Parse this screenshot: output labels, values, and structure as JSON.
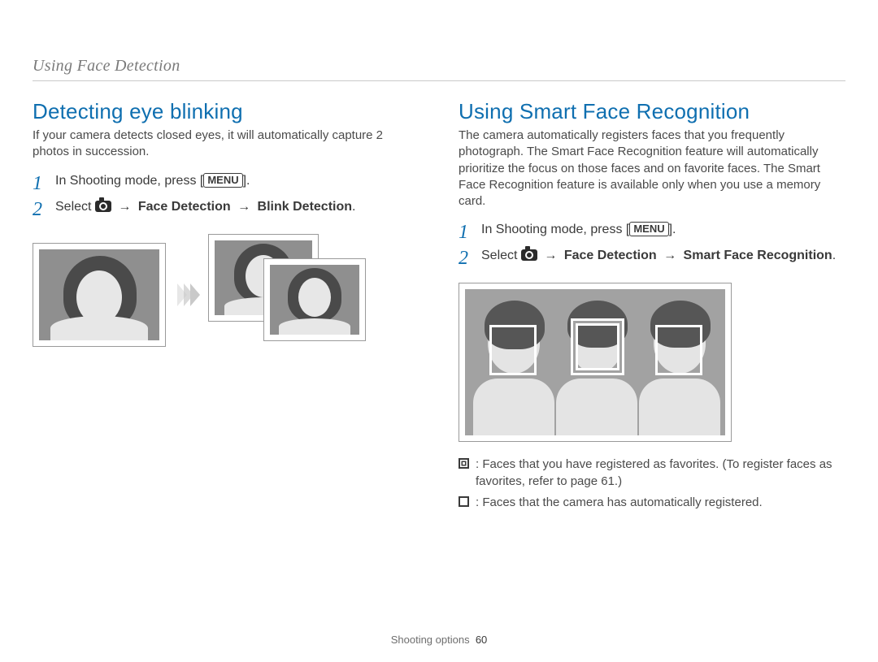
{
  "running_head": "Using Face Detection",
  "left": {
    "heading": "Detecting eye blinking",
    "intro": "If your camera detects closed eyes, it will automatically capture 2 photos in succession.",
    "step1_prefix": "In Shooting mode, press [",
    "step1_suffix": "].",
    "menu_label": "MENU",
    "step2_select": "Select ",
    "step2_path1": "Face Detection",
    "step2_path2": "Blink Detection",
    "arrow": "→",
    "period": "."
  },
  "right": {
    "heading": "Using Smart Face Recognition",
    "intro": "The camera automatically registers faces that you frequently photograph. The Smart Face Recognition feature will automatically prioritize the focus on those faces and on favorite faces. The Smart Face Recognition feature is available only when you use a memory card.",
    "step1_prefix": "In Shooting mode, press [",
    "step1_suffix": "].",
    "menu_label": "MENU",
    "step2_select": "Select ",
    "step2_path1": "Face Detection",
    "step2_path2": "Smart Face Recognition",
    "arrow": "→",
    "period": ".",
    "bullet1": " : Faces that you have registered as favorites. (To register faces as favorites, refer to page 61.)",
    "bullet2": " : Faces that the camera has automatically registered."
  },
  "footer": {
    "section": "Shooting options",
    "page": "60"
  },
  "step_numbers": {
    "one": "1",
    "two": "2"
  }
}
